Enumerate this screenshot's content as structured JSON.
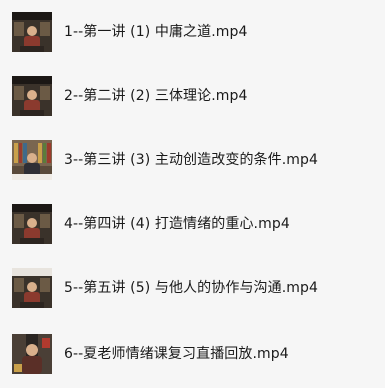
{
  "files": [
    {
      "name": "1--第一讲 (1) 中庸之道.mp4",
      "thumb": "lecture-video-thumbnail-icon"
    },
    {
      "name": "2--第二讲 (2) 三体理论.mp4",
      "thumb": "lecture-video-thumbnail-icon"
    },
    {
      "name": "3--第三讲 (3) 主动创造改变的条件.mp4",
      "thumb": "lecture-video-thumbnail-icon"
    },
    {
      "name": "4--第四讲 (4) 打造情绪的重心.mp4",
      "thumb": "lecture-video-thumbnail-icon"
    },
    {
      "name": "5--第五讲 (5) 与他人的协作与沟通.mp4",
      "thumb": "lecture-video-thumbnail-icon"
    },
    {
      "name": "6--夏老师情绪课复习直播回放.mp4",
      "thumb": "livestream-video-thumbnail-icon"
    }
  ]
}
